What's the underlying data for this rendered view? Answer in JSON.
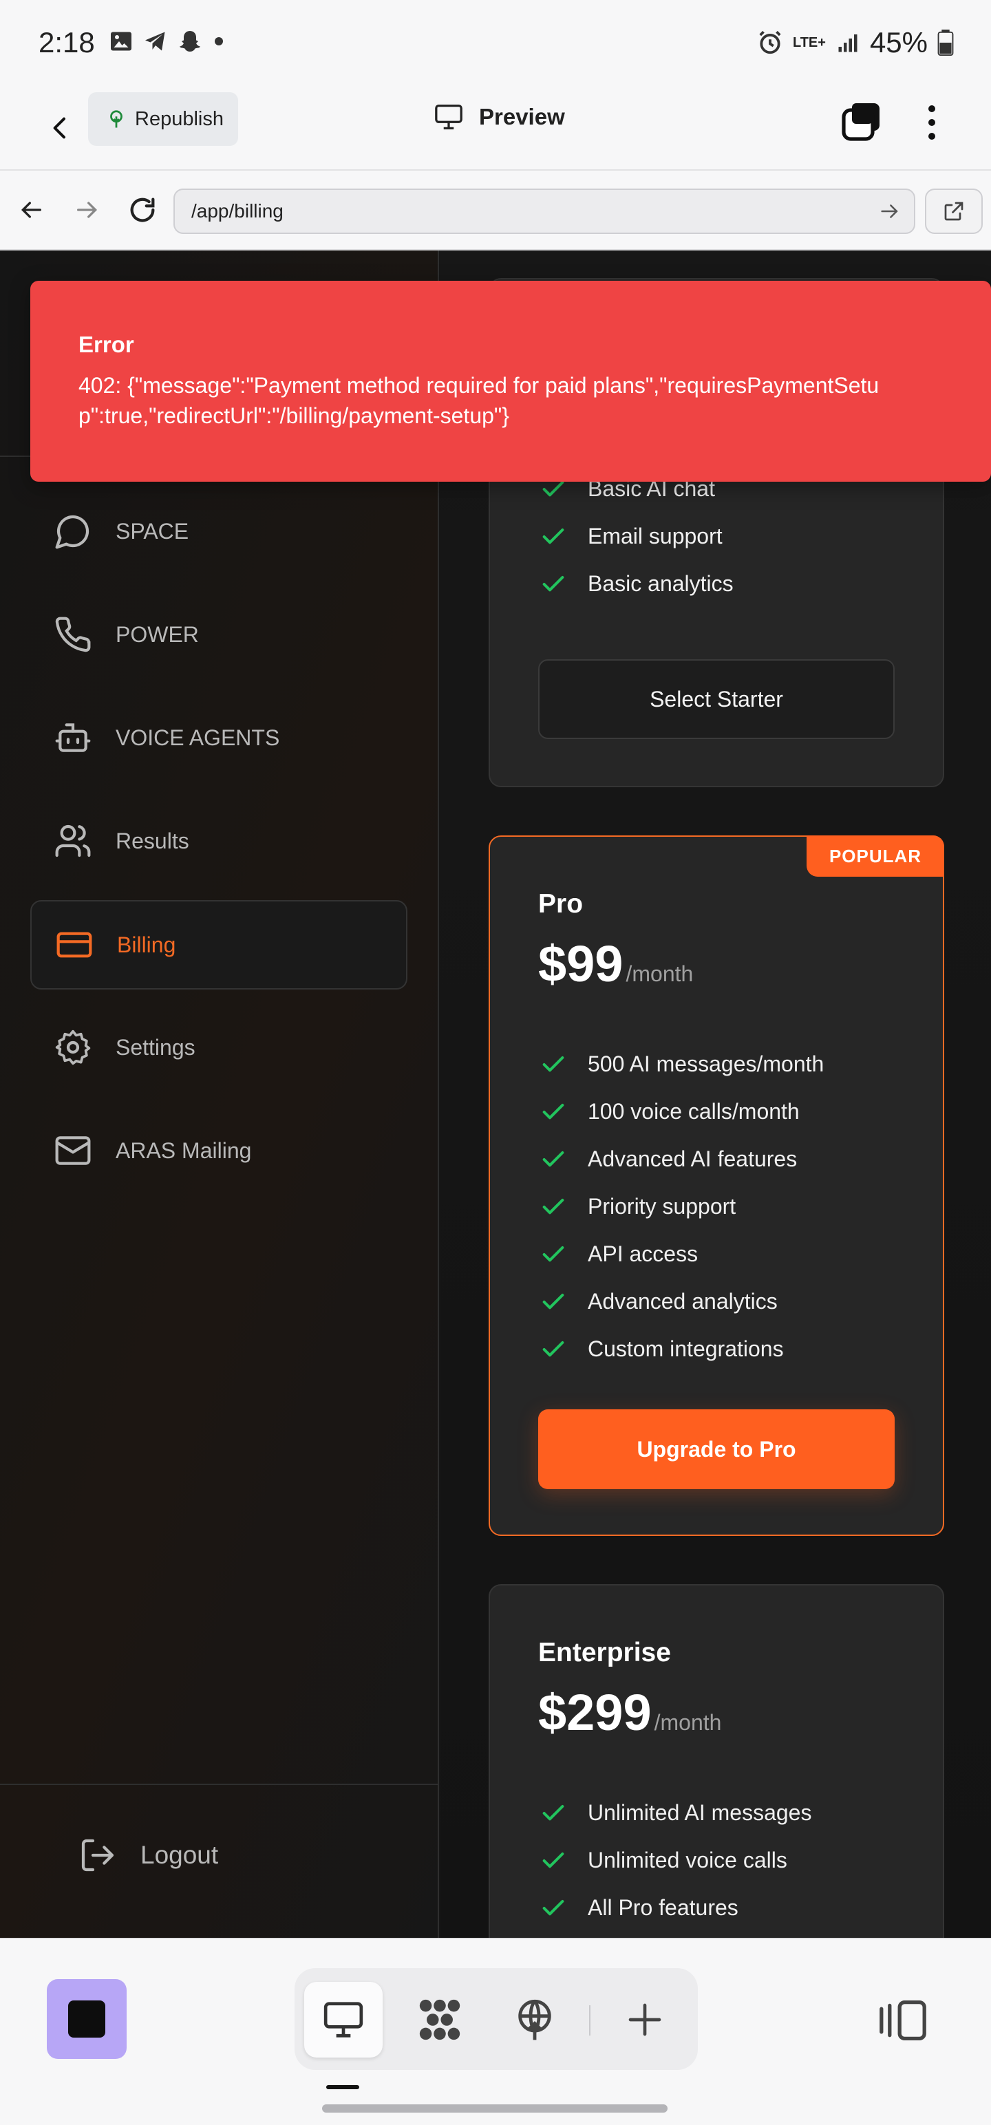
{
  "status_bar": {
    "time": "2:18",
    "network": "LTE+",
    "battery": "45%"
  },
  "app_bar": {
    "republish_label": "Republish",
    "preview_label": "Preview"
  },
  "browser": {
    "url": "/app/billing"
  },
  "toast": {
    "title": "Error",
    "message": "402: {\"message\":\"Payment method required for paid plans\",\"requiresPaymentSetup\":true,\"redirectUrl\":\"/billing/payment-setup\"}",
    "color": "#ef4444"
  },
  "sidebar": {
    "items": [
      {
        "label": "SPACE",
        "icon": "chat-bubble-icon"
      },
      {
        "label": "POWER",
        "icon": "phone-icon"
      },
      {
        "label": "VOICE AGENTS",
        "icon": "robot-icon"
      },
      {
        "label": "Results",
        "icon": "users-icon"
      },
      {
        "label": "Billing",
        "icon": "credit-card-icon",
        "active": true
      },
      {
        "label": "Settings",
        "icon": "gear-icon"
      },
      {
        "label": "ARAS Mailing",
        "icon": "mail-icon"
      }
    ],
    "logout_label": "Logout",
    "accent_color": "#f46a24"
  },
  "plans": {
    "starter": {
      "features": [
        "Basic AI chat",
        "Email support",
        "Basic analytics"
      ],
      "button_label": "Select Starter"
    },
    "pro": {
      "badge": "POPULAR",
      "name": "Pro",
      "price": "$99",
      "period": "/month",
      "features": [
        "500 AI messages/month",
        "100 voice calls/month",
        "Advanced AI features",
        "Priority support",
        "API access",
        "Advanced analytics",
        "Custom integrations"
      ],
      "button_label": "Upgrade to Pro",
      "button_color": "#ff5f1f"
    },
    "enterprise": {
      "name": "Enterprise",
      "price": "$299",
      "period": "/month",
      "features": [
        "Unlimited AI messages",
        "Unlimited voice calls",
        "All Pro features"
      ]
    }
  },
  "bottom_toolbar": {
    "icons": [
      "desktop-icon",
      "cluster-icon",
      "globe-upload-icon",
      "plus-icon",
      "panel-toggle-icon"
    ]
  }
}
